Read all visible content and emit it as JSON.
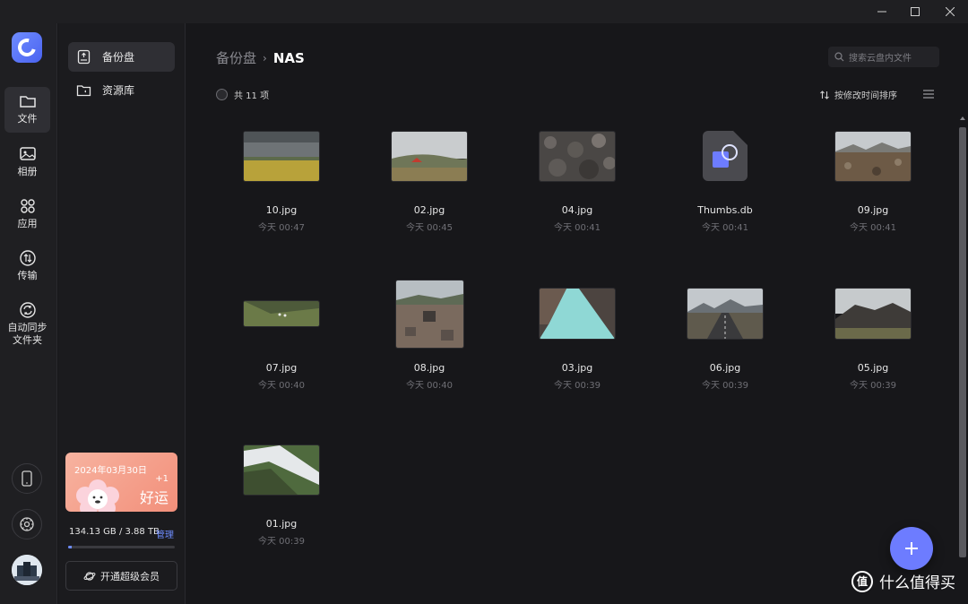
{
  "window": {
    "controls": [
      "minimize",
      "maximize",
      "close"
    ]
  },
  "rail": {
    "items": [
      {
        "label": "文件",
        "icon": "folder-icon"
      },
      {
        "label": "相册",
        "icon": "image-icon"
      },
      {
        "label": "应用",
        "icon": "apps-grid-icon"
      },
      {
        "label": "传输",
        "icon": "transfer-icon"
      },
      {
        "label": "自动同步\n文件夹",
        "icon": "sync-icon"
      }
    ],
    "bottom_icons": [
      "phone-icon",
      "settings-icon",
      "avatar"
    ]
  },
  "sidebar": {
    "items": [
      {
        "label": "备份盘",
        "icon": "backup-drive-icon",
        "active": true
      },
      {
        "label": "资源库",
        "icon": "library-icon",
        "active": false
      }
    ],
    "luck_card": {
      "date": "2024年03月30日",
      "plus": "+1",
      "word": "好运"
    },
    "storage": {
      "text": "134.13 GB / 3.88 TB",
      "manage": "管理",
      "used_fraction": 0.034
    },
    "vip_button": "开通超级会员"
  },
  "main": {
    "breadcrumb": {
      "root": "备份盘",
      "separator": "›",
      "current": "NAS"
    },
    "search_placeholder": "搜索云盘内文件",
    "count_text": "共 11 项",
    "sort_label": "按修改时间排序",
    "files": [
      {
        "name": "10.jpg",
        "date": "今天 00:47"
      },
      {
        "name": "02.jpg",
        "date": "今天 00:45"
      },
      {
        "name": "04.jpg",
        "date": "今天 00:41"
      },
      {
        "name": "Thumbs.db",
        "date": "今天 00:41"
      },
      {
        "name": "09.jpg",
        "date": "今天 00:41"
      },
      {
        "name": "07.jpg",
        "date": "今天 00:40"
      },
      {
        "name": "08.jpg",
        "date": "今天 00:40"
      },
      {
        "name": "03.jpg",
        "date": "今天 00:39"
      },
      {
        "name": "06.jpg",
        "date": "今天 00:39"
      },
      {
        "name": "05.jpg",
        "date": "今天 00:39"
      },
      {
        "name": "01.jpg",
        "date": "今天 00:39"
      }
    ]
  },
  "watermark": {
    "text": "什么值得买",
    "icon": "值"
  },
  "colors": {
    "accent": "#6d7cff",
    "background": "#17171a",
    "panel": "#1f1f22"
  }
}
